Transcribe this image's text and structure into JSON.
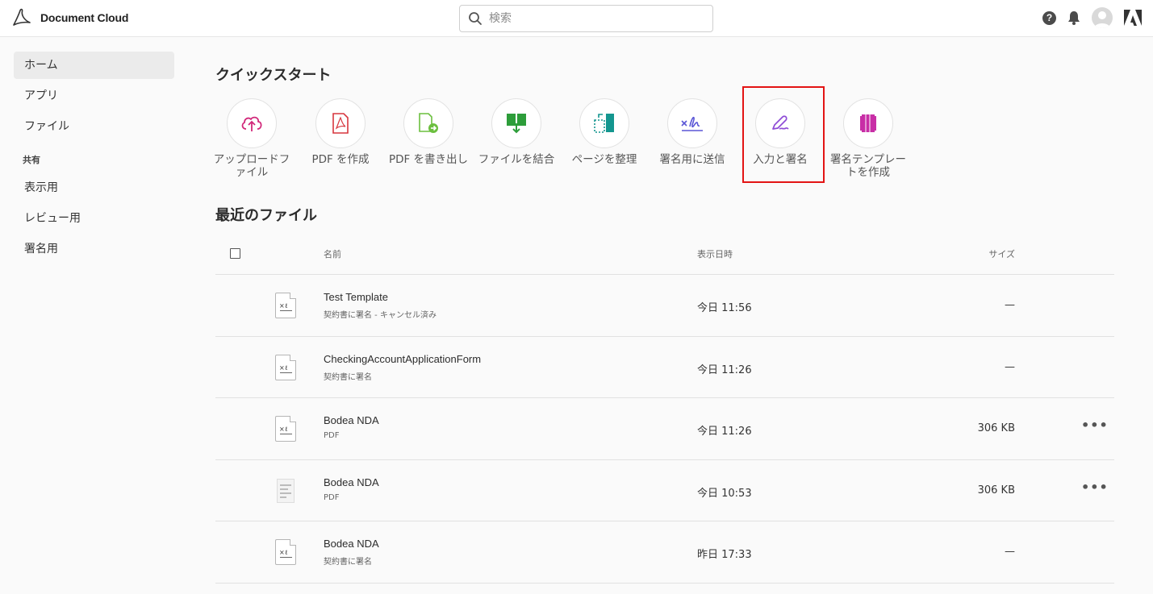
{
  "header": {
    "brand": "Document Cloud",
    "search_placeholder": "検索"
  },
  "sidebar": {
    "items": [
      {
        "label": "ホーム"
      },
      {
        "label": "アプリ"
      },
      {
        "label": "ファイル"
      }
    ],
    "shared_heading": "共有",
    "shared_items": [
      {
        "label": "表示用"
      },
      {
        "label": "レビュー用"
      },
      {
        "label": "署名用"
      }
    ]
  },
  "quickstart": {
    "title": "クイックスタート",
    "items": [
      {
        "label": "アップロードファイル",
        "icon": "cloud-upload-icon",
        "color": "#d1287a"
      },
      {
        "label": "PDF を作成",
        "icon": "create-pdf-icon",
        "color": "#d7373f"
      },
      {
        "label": "PDF を書き出し",
        "icon": "export-pdf-icon",
        "color": "#6cbf3f"
      },
      {
        "label": "ファイルを結合",
        "icon": "combine-files-icon",
        "color": "#2d9d3a"
      },
      {
        "label": "ページを整理",
        "icon": "organize-pages-icon",
        "color": "#14968f"
      },
      {
        "label": "署名用に送信",
        "icon": "send-for-signature-icon",
        "color": "#5a56d6"
      },
      {
        "label": "入力と署名",
        "icon": "fill-sign-icon",
        "color": "#8e4bd6"
      },
      {
        "label": "署名テンプレートを作成",
        "icon": "signature-template-icon",
        "color": "#c82ea6"
      }
    ]
  },
  "recent": {
    "title": "最近のファイル",
    "columns": {
      "name": "名前",
      "date": "表示日時",
      "size": "サイズ"
    },
    "rows": [
      {
        "name": "Test Template",
        "sub": "契約書に署名 - キャンセル済み",
        "date": "今日 11:56",
        "size": "—",
        "thumb": "sign"
      },
      {
        "name": "CheckingAccountApplicationForm",
        "sub": "契約書に署名",
        "date": "今日 11:26",
        "size": "—",
        "thumb": "sign"
      },
      {
        "name": "Bodea NDA",
        "sub": "PDF",
        "date": "今日 11:26",
        "size": "306 KB",
        "thumb": "sign",
        "more": "•••"
      },
      {
        "name": "Bodea NDA",
        "sub": "PDF",
        "date": "今日 10:53",
        "size": "306 KB",
        "thumb": "image",
        "more": "•••"
      },
      {
        "name": "Bodea NDA",
        "sub": "契約書に署名",
        "date": "昨日 17:33",
        "size": "—",
        "thumb": "sign"
      }
    ]
  }
}
